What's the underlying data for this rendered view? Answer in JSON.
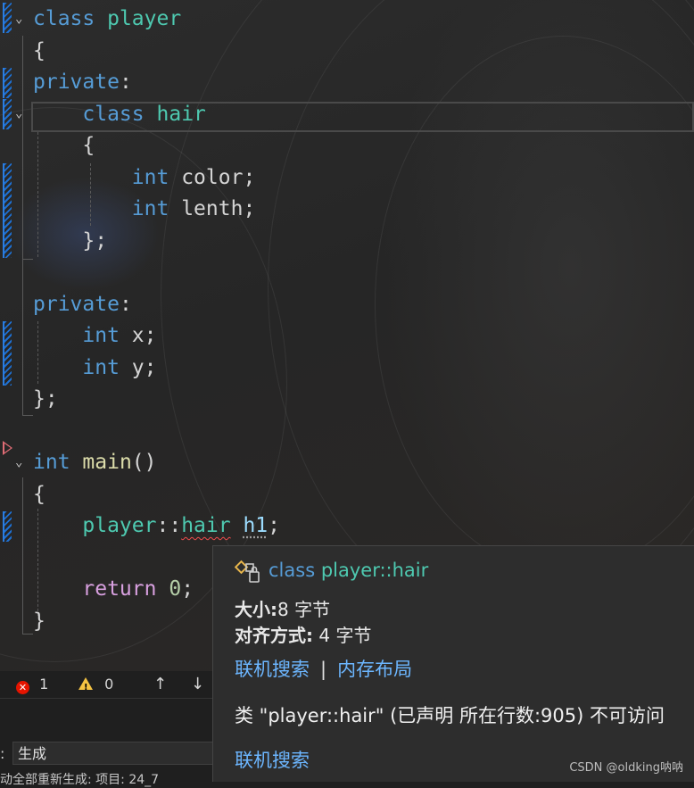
{
  "code_lines": [
    [
      {
        "t": "class",
        "c": "kw"
      },
      {
        "t": " "
      },
      {
        "t": "player",
        "c": "ty"
      }
    ],
    [
      {
        "t": "{"
      }
    ],
    [
      {
        "t": "private",
        "c": "kw"
      },
      {
        "t": ":"
      }
    ],
    [
      {
        "t": "    "
      },
      {
        "t": "class",
        "c": "kw"
      },
      {
        "t": " "
      },
      {
        "t": "hair",
        "c": "ty"
      }
    ],
    [
      {
        "t": "    {"
      }
    ],
    [
      {
        "t": "        "
      },
      {
        "t": "int",
        "c": "kw"
      },
      {
        "t": " "
      },
      {
        "t": "color"
      },
      {
        "t": ";"
      }
    ],
    [
      {
        "t": "        "
      },
      {
        "t": "int",
        "c": "kw"
      },
      {
        "t": " "
      },
      {
        "t": "lenth"
      },
      {
        "t": ";"
      }
    ],
    [
      {
        "t": "    };"
      }
    ],
    [],
    [
      {
        "t": "private",
        "c": "kw"
      },
      {
        "t": ":"
      }
    ],
    [
      {
        "t": "    "
      },
      {
        "t": "int",
        "c": "kw"
      },
      {
        "t": " "
      },
      {
        "t": "x"
      },
      {
        "t": ";"
      }
    ],
    [
      {
        "t": "    "
      },
      {
        "t": "int",
        "c": "kw"
      },
      {
        "t": " "
      },
      {
        "t": "y"
      },
      {
        "t": ";"
      }
    ],
    [
      {
        "t": "};"
      }
    ],
    [],
    [
      {
        "t": "int",
        "c": "kw"
      },
      {
        "t": " "
      },
      {
        "t": "main",
        "c": "fn"
      },
      {
        "t": "()"
      }
    ],
    [
      {
        "t": "{"
      }
    ],
    [
      {
        "t": "    "
      },
      {
        "t": "player",
        "c": "ty"
      },
      {
        "t": "::"
      },
      {
        "t": "hair",
        "c": "ty squig"
      },
      {
        "t": " "
      },
      {
        "t": "h1",
        "c": "var dotted"
      },
      {
        "t": ";"
      }
    ],
    [],
    [
      {
        "t": "    "
      },
      {
        "t": "return",
        "c": "ctl"
      },
      {
        "t": " "
      },
      {
        "t": "0",
        "c": "num"
      },
      {
        "t": ";"
      }
    ],
    [
      {
        "t": "}"
      }
    ]
  ],
  "status": {
    "errors": "1",
    "warnings": "0",
    "up_arrow": "↑",
    "down_arrow": "↓",
    "error_icon": "error-circle-icon",
    "warning_icon": "warning-triangle-icon"
  },
  "output": {
    "label": ":",
    "source": "生成",
    "text": "动全部重新生成: 项目: 24_7"
  },
  "tooltip": {
    "icon": "nested-class-icon",
    "sig_kw": "class",
    "sig_name": "player::hair",
    "size_label": "大小:",
    "size_value": "8 字节",
    "align_label": "对齐方式:",
    "align_value": " 4 字节",
    "link_search": "联机搜索",
    "separator": "|",
    "link_layout": "内存布局",
    "error_message": "类 \"player::hair\" (已声明 所在行数:905) 不可访问",
    "link_search2": "联机搜索"
  },
  "watermark": "CSDN @oldking呐呐",
  "colors": {
    "keyword": "#569cd6",
    "type": "#4ec9b0",
    "function": "#dcdcaa",
    "control": "#d8a0df",
    "number": "#b5cea8",
    "link": "#6cb6ff",
    "error": "#e51400"
  }
}
